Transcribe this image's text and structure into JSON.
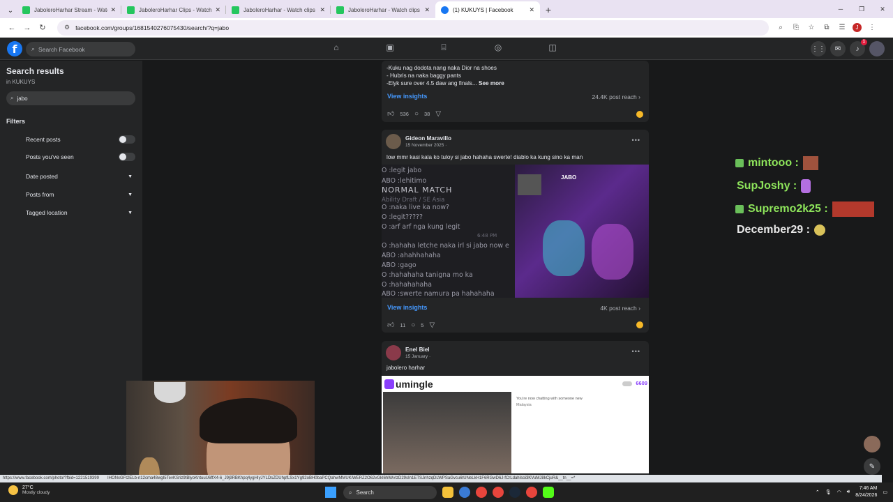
{
  "browser": {
    "tabs": [
      {
        "title": "JaboleroHarhar Stream - Watch"
      },
      {
        "title": "JaboleroHarhar Clips - Watch t"
      },
      {
        "title": "JaboleroHarhar - Watch clips or"
      },
      {
        "title": "JaboleroHarhar - Watch clips or"
      },
      {
        "title": "(1) KUKUYS | Facebook"
      }
    ],
    "url": "facebook.com/groups/1681540276075430/search/?q=jabo",
    "profile_initial": "J"
  },
  "facebook": {
    "search_placeholder": "Search Facebook",
    "notif_count": "1"
  },
  "sidebar": {
    "title": "Search results",
    "subtitle": "in KUKUYS",
    "query": "jabo",
    "filters_heading": "Filters",
    "filters": [
      {
        "label": "Recent posts",
        "control": "toggle"
      },
      {
        "label": "Posts you've seen",
        "control": "toggle"
      },
      {
        "label": "Date posted",
        "control": "dropdown"
      },
      {
        "label": "Posts from",
        "control": "dropdown"
      },
      {
        "label": "Tagged location",
        "control": "dropdown"
      }
    ]
  },
  "post1": {
    "lines": [
      "-Kuku nag dodota nang naka Dior na shoes",
      "- Hubris na naka baggy pants",
      "-Elyk sure over 4.5 daw ang finals..."
    ],
    "see_more": "See more",
    "insights": "View insights",
    "reach": "24.4K post reach",
    "likes": "536",
    "comments": "38"
  },
  "post2": {
    "author": "Gideon Maravillo",
    "date": "15 November 2025 ·",
    "text": "low mmr kasi kala ko tuloy si jabo hahaha swerte! diablo ka kung sino ka man",
    "chat_lines": [
      "O   :legit jabo",
      "ABO  :lehitimo",
      "NORMAL MATCH",
      "Ability Draft / SE Asia",
      "O   :naka live ka now?",
      "O   :legit?????",
      "O   :arf arf nga kung legit",
      "6:48 PM",
      "O   :hahaha letche naka irl si jabo now e",
      "ABO  :ahahhahaha",
      "ABO  :gago",
      "O   :hahahaha tanigna mo ka",
      "O   :hahahahaha",
      "ABO  :swerte namura pa hahahaha"
    ],
    "game_name": "JABO",
    "insights": "View insights",
    "reach": "4K post reach",
    "likes": "11",
    "comments": "5"
  },
  "post3": {
    "author": "Enel Biel",
    "date": "15 January ·",
    "text": "jabolero harhar",
    "app_name": "umingle",
    "online_count": "6609",
    "chat_msg": "You're now chatting with someone new",
    "location": "Malaysia"
  },
  "stream_chat": [
    {
      "user": "mintooo",
      "mod": true,
      "color": "#8ee55b"
    },
    {
      "user": "SupJoshy",
      "mod": false,
      "color": "#8ee55b"
    },
    {
      "user": "Supremo2k25",
      "mod": true,
      "color": "#8ee55b"
    },
    {
      "user": "December29",
      "mod": false,
      "color": "#e8e8e8"
    }
  ],
  "status_url": "https://www.facebook.com/photo/?fbid=1221519399",
  "status_url_tail": "IHONxGFt2ELb-n12cma48wgI5TevKSriz9tBlyoKntuuU6ffX4-6_J9j9RBKhpq4ygHIyJYLDsZDUhpfLSx1Yg92oBH0baPCQahwMMUKiWERZ2O62vGkI6hlWvIzD29sIn1ETSJnhzqDLWPSaGvcu6tUNeLkH1F6RGwD6J-fCrLdahIsoi3KVuMJ8kCjuR&__tn__=*",
  "taskbar": {
    "temp": "27°C",
    "weather": "Mostly cloudy",
    "search": "Search",
    "time": "7:46 AM",
    "date": "8/24/2026"
  }
}
